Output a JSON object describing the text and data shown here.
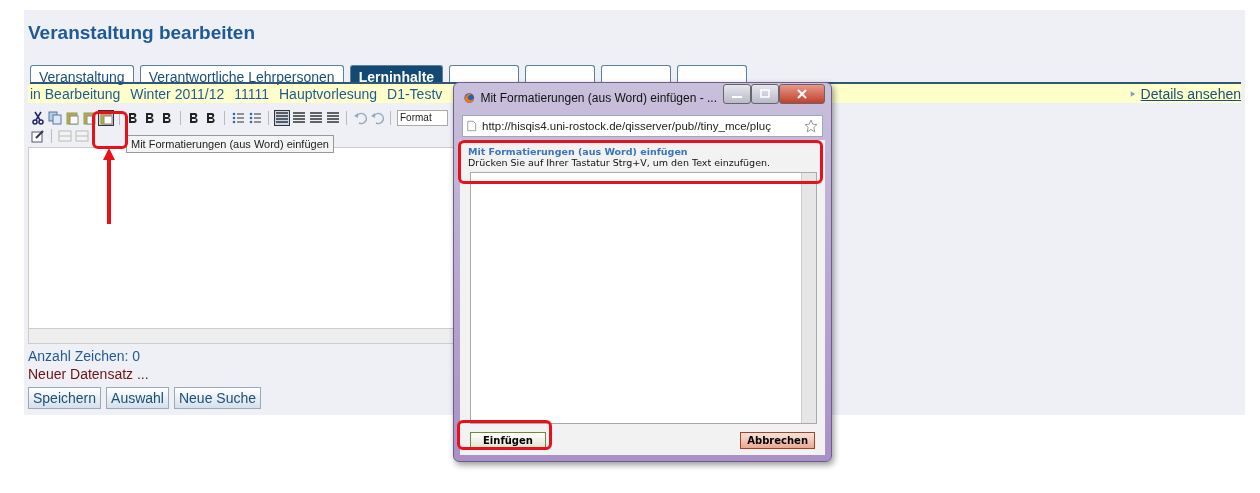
{
  "page_title": "Veranstaltung bearbeiten",
  "tabs": [
    {
      "label": "Veranstaltung",
      "selected": false
    },
    {
      "label": "Verantwortliche Lehrpersonen",
      "selected": false
    },
    {
      "label": "Lerninhalte",
      "selected": true
    },
    {
      "selected": false
    },
    {
      "selected": false
    },
    {
      "selected": false
    },
    {
      "selected": false
    }
  ],
  "info_bar": {
    "items": [
      "in Bearbeitung",
      "Winter 2011/12",
      "11111",
      "Hauptvorlesung",
      "D1-Testv"
    ],
    "link": "Details ansehen"
  },
  "editor": {
    "format_select": "Format",
    "tooltip": "Mit Formatierungen (aus Word) einfügen",
    "char_count": "Anzahl Zeichen: 0",
    "record_status": "Neuer Datensatz ..."
  },
  "buttons": [
    "Speichern",
    "Auswahl",
    "Neue Suche"
  ],
  "dialog": {
    "title": "Mit Formatierungen (aus Word) einfügen - ...",
    "url": "http://hisqis4.uni-rostock.de/qisserver/pub//tiny_mce/pluç",
    "heading": "Mit Formatierungen (aus Word) einfügen",
    "instruction": "Drücken Sie auf Ihrer Tastatur Strg+V, um den Text einzufügen.",
    "insert_button": "Einfügen",
    "cancel_button": "Abbrechen"
  }
}
